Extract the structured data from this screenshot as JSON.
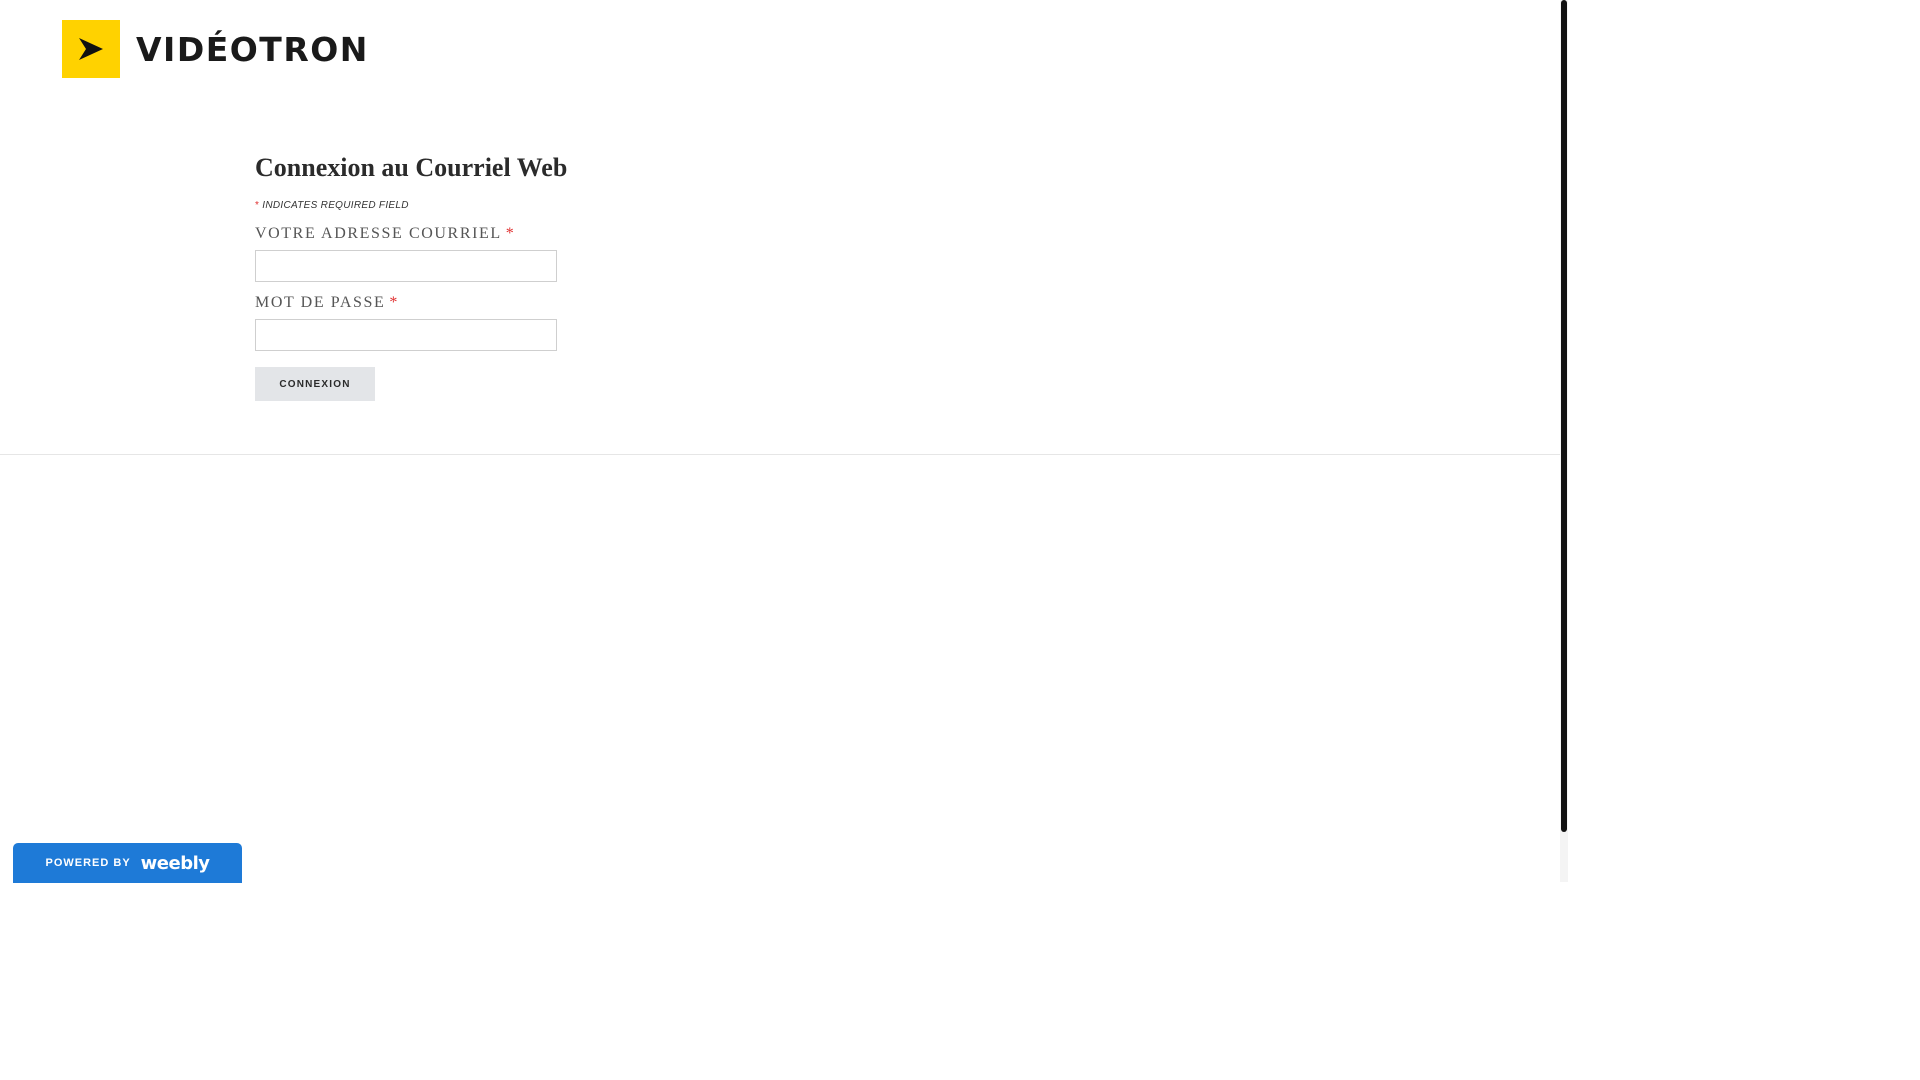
{
  "brand": {
    "name": "VIDÉOTRON",
    "mark_color": "#ffd200"
  },
  "login_form": {
    "title": "Connexion au Courriel Web",
    "required_star": "*",
    "required_note": "INDICATES REQUIRED FIELD",
    "email": {
      "label": "VOTRE ADRESSE COURRIEL",
      "value": "",
      "placeholder": ""
    },
    "password": {
      "label": "MOT DE PASSE",
      "value": "",
      "placeholder": ""
    },
    "submit_label": "CONNEXION"
  },
  "footer_badge": {
    "powered_by": "POWERED BY",
    "brand": "weebly",
    "color": "#1e7ad7"
  },
  "icons": {
    "logo_mark": "play-arrow-icon"
  }
}
